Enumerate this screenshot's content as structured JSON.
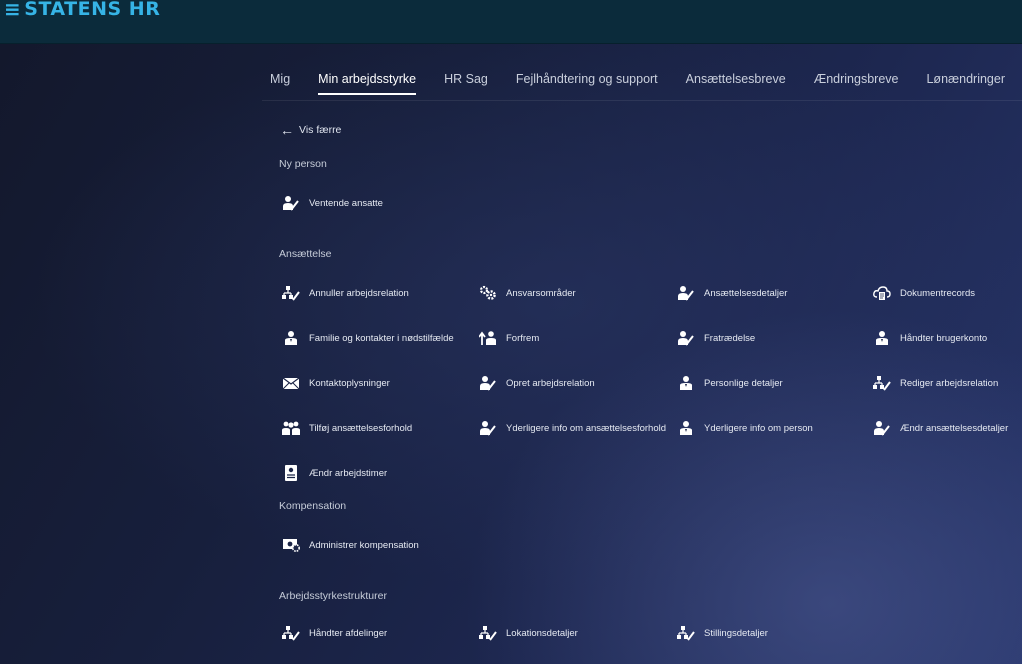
{
  "app": {
    "title": "STATENS HR",
    "menu_glyph": "≡"
  },
  "tabs": [
    {
      "label": "Mig"
    },
    {
      "label": "Min arbejdsstyrke",
      "active": true
    },
    {
      "label": "HR Sag"
    },
    {
      "label": "Fejlhåndtering og support"
    },
    {
      "label": "Ansættelsesbreve"
    },
    {
      "label": "Ændringsbreve"
    },
    {
      "label": "Lønændringer"
    }
  ],
  "back": {
    "label": "Vis færre",
    "arrow": "←"
  },
  "sections": {
    "ny_person": {
      "title": "Ny person",
      "items": [
        {
          "label": "Ventende ansatte",
          "icon": "person-edit-icon"
        }
      ]
    },
    "ansaettelse": {
      "title": "Ansættelse",
      "items": [
        {
          "label": "Annuller arbejdsrelation",
          "icon": "org-edit-icon"
        },
        {
          "label": "Ansvarsområder",
          "icon": "gears-icon"
        },
        {
          "label": "Ansættelsesdetaljer",
          "icon": "person-edit-icon"
        },
        {
          "label": "Dokumentrecords",
          "icon": "cloud-document-icon"
        },
        {
          "label": "Familie og kontakter i nødstilfælde",
          "icon": "person-icon"
        },
        {
          "label": "Forfrem",
          "icon": "person-promote-icon"
        },
        {
          "label": "Fratrædelse",
          "icon": "person-edit-icon"
        },
        {
          "label": "Håndter brugerkonto",
          "icon": "person-icon"
        },
        {
          "label": "Kontaktoplysninger",
          "icon": "envelope-icon"
        },
        {
          "label": "Opret arbejdsrelation",
          "icon": "person-edit-icon"
        },
        {
          "label": "Personlige detaljer",
          "icon": "person-icon"
        },
        {
          "label": "Rediger arbejdsrelation",
          "icon": "org-edit-icon"
        },
        {
          "label": "Tilføj ansættelsesforhold",
          "icon": "people-icon"
        },
        {
          "label": "Yderligere info om ansættelsesforhold",
          "icon": "person-edit-icon"
        },
        {
          "label": "Yderligere info om person",
          "icon": "person-icon"
        },
        {
          "label": "Ændr ansættelsesdetaljer",
          "icon": "person-edit-icon"
        },
        {
          "label": "Ændr arbejdstimer",
          "icon": "badge-icon"
        }
      ]
    },
    "kompensation": {
      "title": "Kompensation",
      "items": [
        {
          "label": "Administrer kompensation",
          "icon": "money-gear-icon"
        }
      ]
    },
    "arbejdsstyrkestrukturer": {
      "title": "Arbejdsstyrkestrukturer",
      "items": [
        {
          "label": "Håndter afdelinger",
          "icon": "org-edit-icon"
        },
        {
          "label": "Lokationsdetaljer",
          "icon": "org-edit-icon"
        },
        {
          "label": "Stillingsdetaljer",
          "icon": "org-edit-icon"
        }
      ]
    }
  },
  "colors": {
    "topbar": "#0b2b3b",
    "brand": "#36b4e6",
    "background_start": "#13182c",
    "background_end": "#27356a",
    "text": "#e6eaf2"
  }
}
